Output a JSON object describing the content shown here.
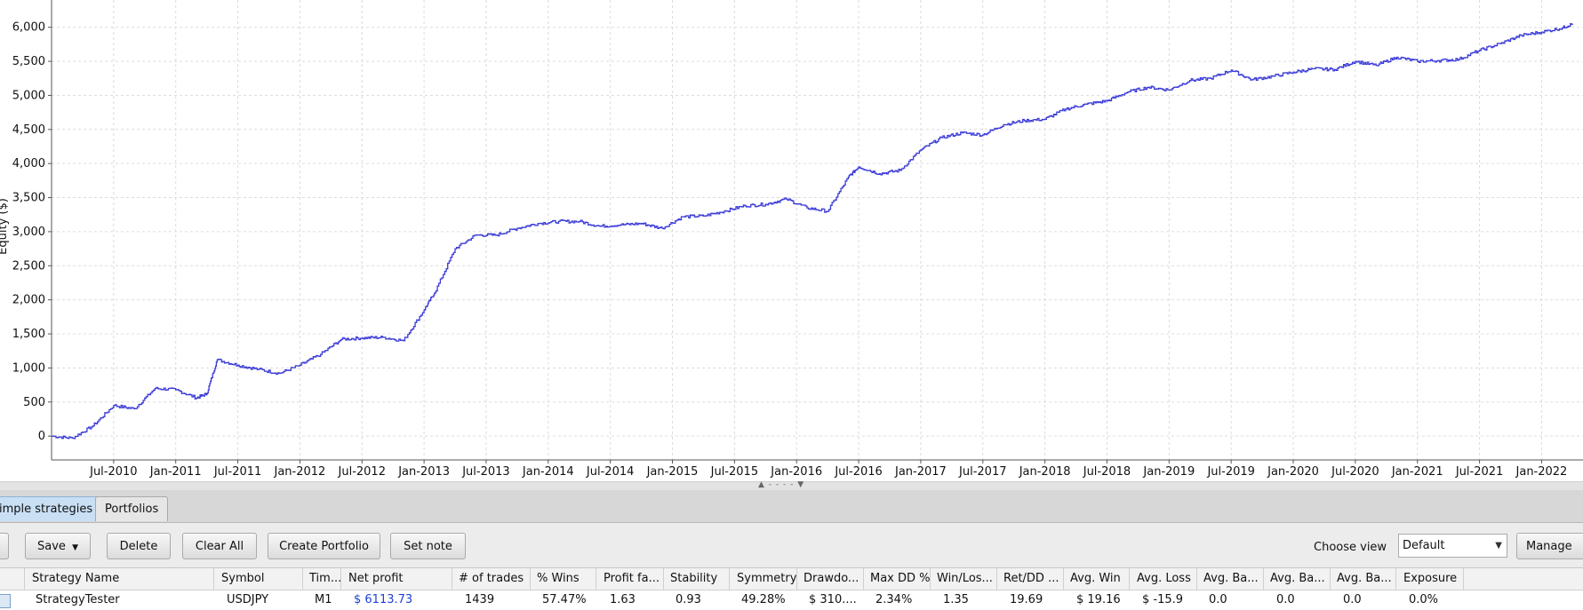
{
  "chart_data": {
    "type": "line",
    "ylabel": "Equity ($)",
    "xlabel": "",
    "ylim": [
      -350,
      6400
    ],
    "y_ticks": [
      0,
      500,
      1000,
      1500,
      2000,
      2500,
      3000,
      3500,
      4000,
      4500,
      5000,
      5500,
      6000
    ],
    "y_tick_labels": [
      "0",
      "500",
      "1,000",
      "1,500",
      "2,000",
      "2,500",
      "3,000",
      "3,500",
      "4,000",
      "4,500",
      "5,000",
      "5,500",
      "6,000"
    ],
    "x_tick_labels": [
      "Jul-2010",
      "Jan-2011",
      "Jul-2011",
      "Jan-2012",
      "Jul-2012",
      "Jan-2013",
      "Jul-2013",
      "Jan-2014",
      "Jul-2014",
      "Jan-2015",
      "Jul-2015",
      "Jan-2016",
      "Jul-2016",
      "Jan-2017",
      "Jul-2017",
      "Jan-2018",
      "Jul-2018",
      "Jan-2019",
      "Jul-2019",
      "Jan-2020",
      "Jul-2020",
      "Jan-2021",
      "Jul-2021",
      "Jan-2022"
    ],
    "grid": true,
    "line_color": "#3a3ad8",
    "series": [
      {
        "x": [
          "2010-01",
          "2010-03",
          "2010-05",
          "2010-07",
          "2010-09",
          "2010-11",
          "2011-01",
          "2011-03",
          "2011-04",
          "2011-05",
          "2011-07",
          "2011-09",
          "2011-11",
          "2012-01",
          "2012-03",
          "2012-05",
          "2012-07",
          "2012-09",
          "2012-11",
          "2013-01",
          "2013-02",
          "2013-04",
          "2013-06",
          "2013-08",
          "2013-10",
          "2013-12",
          "2014-02",
          "2014-04",
          "2014-06",
          "2014-08",
          "2014-10",
          "2014-12",
          "2015-02",
          "2015-04",
          "2015-06",
          "2015-08",
          "2015-10",
          "2015-12",
          "2016-02",
          "2016-04",
          "2016-06",
          "2016-07",
          "2016-09",
          "2016-11",
          "2017-01",
          "2017-03",
          "2017-05",
          "2017-07",
          "2017-09",
          "2017-11",
          "2018-01",
          "2018-03",
          "2018-05",
          "2018-07",
          "2018-09",
          "2018-11",
          "2019-01",
          "2019-03",
          "2019-05",
          "2019-07",
          "2019-09",
          "2019-11",
          "2020-01",
          "2020-03",
          "2020-05",
          "2020-07",
          "2020-09",
          "2020-11",
          "2021-01",
          "2021-03",
          "2021-05",
          "2021-07",
          "2021-09",
          "2021-11",
          "2022-01",
          "2022-03",
          "2022-04"
        ],
        "values": [
          0,
          -30,
          150,
          450,
          400,
          700,
          680,
          560,
          620,
          1120,
          1040,
          980,
          920,
          1040,
          1200,
          1420,
          1440,
          1450,
          1400,
          1850,
          2100,
          2750,
          2950,
          2950,
          3050,
          3120,
          3150,
          3150,
          3080,
          3100,
          3120,
          3050,
          3220,
          3230,
          3300,
          3380,
          3400,
          3480,
          3350,
          3300,
          3800,
          3950,
          3850,
          3900,
          4200,
          4380,
          4450,
          4420,
          4570,
          4630,
          4650,
          4800,
          4870,
          4920,
          5050,
          5120,
          5080,
          5220,
          5250,
          5370,
          5230,
          5280,
          5340,
          5390,
          5380,
          5500,
          5440,
          5560,
          5500,
          5510,
          5530,
          5660,
          5760,
          5880,
          5930,
          5990,
          6050
        ]
      }
    ]
  },
  "splitter": {
    "grip": "▲ - - - - ▼"
  },
  "tabs": [
    {
      "label": "imple strategies",
      "active": true
    },
    {
      "label": "Portfolios",
      "active": false
    }
  ],
  "toolbar": {
    "save_label": "Save",
    "save_arrow": "▼",
    "delete_label": "Delete",
    "clear_all_label": "Clear All",
    "create_portfolio_label": "Create Portfolio",
    "set_note_label": "Set note",
    "choose_view_label": "Choose view",
    "view_value": "Default",
    "view_arrow": "▼",
    "manage_label": "Manage"
  },
  "table": {
    "columns": [
      "Strategy Name",
      "Symbol",
      "Tim...",
      "Net profit",
      "# of trades",
      "% Wins",
      "Profit fa...",
      "Stability",
      "Symmetry",
      "Drawdo...",
      "Max DD %",
      "Win/Los...",
      "Ret/DD ...",
      "Avg. Win",
      "Avg. Loss",
      "Avg. Ba...",
      "Avg. Ba...",
      "Avg. Ba...",
      "Exposure"
    ],
    "row": [
      "StrategyTester",
      "USDJPY",
      "M1",
      "$ 6113.73",
      "1439",
      "57.47%",
      "1.63",
      "0.93",
      "49.28%",
      "$ 310....",
      "2.34%",
      "1.35",
      "19.69",
      "$ 19.16",
      "$ -15.9",
      "0.0",
      "0.0",
      "0.0",
      "0.0%"
    ]
  }
}
